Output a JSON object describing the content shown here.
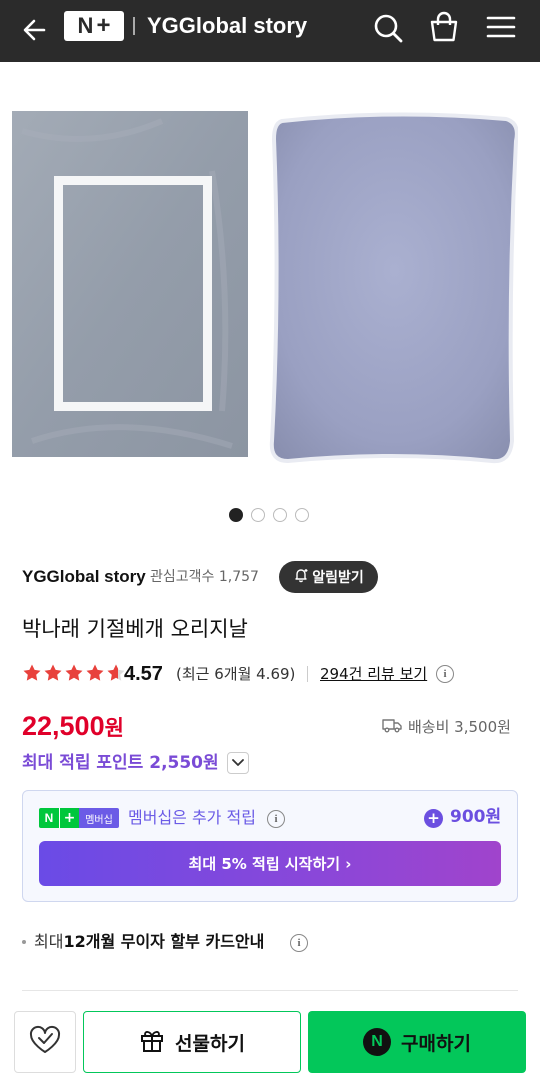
{
  "header": {
    "logo_n": "N",
    "logo_plus": "+",
    "store_title": "YGGlobal story",
    "back_icon": "arrow-left-icon",
    "search_icon": "search-icon",
    "cart_icon": "shopping-bag-icon",
    "menu_icon": "hamburger-menu-icon"
  },
  "gallery": {
    "image_count": 4,
    "active_index": 0
  },
  "store": {
    "name": "YGGlobal story",
    "followers": "관심고객수 1,757",
    "alarm_label": "알림받기"
  },
  "product": {
    "title": "박나래 기절베개 오리지날"
  },
  "rating": {
    "value": "4.57",
    "stars_filled": 4.57,
    "recent": "(최근 6개월 4.69)",
    "review_link": "294건 리뷰 보기"
  },
  "price": {
    "amount": "22,500",
    "unit": "원",
    "shipping": "배송비 3,500원"
  },
  "points": {
    "label": "최대 적립 포인트 2,550원"
  },
  "membership": {
    "badge_n": "N",
    "badge_plus": "+",
    "badge_label": "멤버십",
    "text": "멤버십은 추가 적립",
    "amount": "900원",
    "cta": "최대 5% 적립 시작하기 ›"
  },
  "card_note": {
    "prefix": "최대 ",
    "bold": "12개월 무이자 할부 카드안내"
  },
  "bottom": {
    "gift_label": "선물하기",
    "buy_label": "구매하기",
    "buy_badge": "N"
  },
  "colors": {
    "header_bg": "#2b2b2b",
    "price_red": "#e0002a",
    "points_purple": "#7a4bd6",
    "naver_green": "#03c75a",
    "star_red": "#e8413c"
  }
}
